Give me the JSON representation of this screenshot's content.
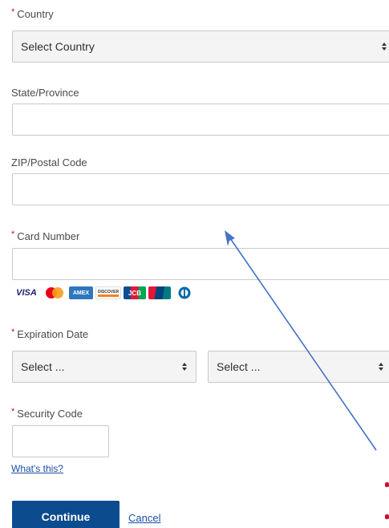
{
  "form": {
    "country": {
      "label": "Country",
      "required": true,
      "value": "Select Country"
    },
    "state": {
      "label": "State/Province",
      "value": ""
    },
    "zip": {
      "label": "ZIP/Postal Code",
      "value": ""
    },
    "card_number": {
      "label": "Card Number",
      "required": true,
      "value": ""
    },
    "card_logos": [
      "VISA",
      "mastercard-icon",
      "AMEX",
      "DISCOVER",
      "JCB",
      "unionpay-icon",
      "diners-club-icon"
    ],
    "expiration": {
      "label": "Expiration Date",
      "required": true,
      "month_value": "Select ...",
      "year_value": "Select ..."
    },
    "security_code": {
      "label": "Security Code",
      "required": true,
      "value": "",
      "help_link": "What's this?"
    },
    "required_marker": "*"
  },
  "actions": {
    "continue_label": "Continue",
    "cancel_label": "Cancel"
  },
  "colors": {
    "primary_button": "#0b4b8e",
    "link": "#1a4fa3",
    "required": "#c8102e",
    "annotation_arrow": "#4472c4"
  }
}
